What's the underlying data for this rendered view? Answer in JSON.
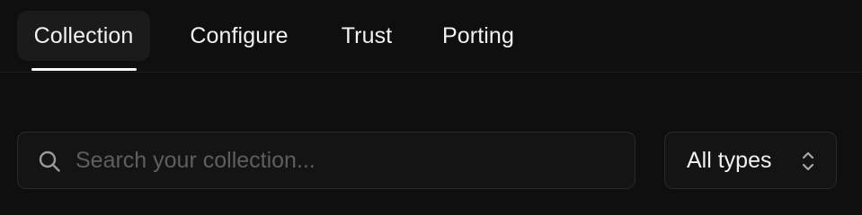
{
  "tabs": [
    {
      "label": "Collection",
      "active": true
    },
    {
      "label": "Configure",
      "active": false
    },
    {
      "label": "Trust",
      "active": false
    },
    {
      "label": "Porting",
      "active": false
    }
  ],
  "search": {
    "placeholder": "Search your collection...",
    "value": "",
    "icon": "search-icon"
  },
  "type_filter": {
    "selected": "All types",
    "icon": "chevron-up-down-icon"
  },
  "colors": {
    "background": "#0f0f0f",
    "surface": "#141414",
    "active_tab_bg": "#1b1b1b",
    "border": "#2a2a2a",
    "text": "#f2f2f2",
    "placeholder": "#5e5e5e",
    "underline": "#ffffff"
  }
}
